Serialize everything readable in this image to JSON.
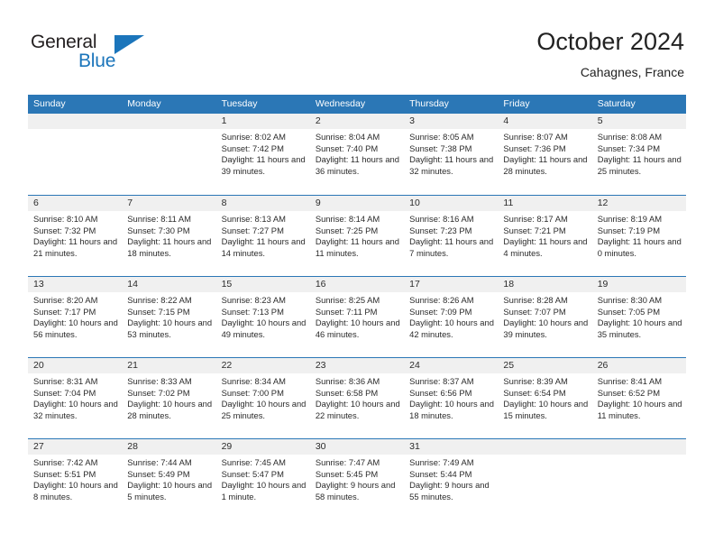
{
  "brand": {
    "name_top": "General",
    "name_bottom": "Blue",
    "accent_color": "#1b75bb"
  },
  "header": {
    "title": "October 2024",
    "subtitle": "Cahagnes, France"
  },
  "calendar": {
    "header_color": "#2b77b6",
    "day_band_color": "#f0f0f0",
    "weekdays": [
      "Sunday",
      "Monday",
      "Tuesday",
      "Wednesday",
      "Thursday",
      "Friday",
      "Saturday"
    ],
    "weeks": [
      [
        {
          "day": "",
          "sunrise": "",
          "sunset": "",
          "daylight": ""
        },
        {
          "day": "",
          "sunrise": "",
          "sunset": "",
          "daylight": ""
        },
        {
          "day": "1",
          "sunrise": "Sunrise: 8:02 AM",
          "sunset": "Sunset: 7:42 PM",
          "daylight": "Daylight: 11 hours and 39 minutes."
        },
        {
          "day": "2",
          "sunrise": "Sunrise: 8:04 AM",
          "sunset": "Sunset: 7:40 PM",
          "daylight": "Daylight: 11 hours and 36 minutes."
        },
        {
          "day": "3",
          "sunrise": "Sunrise: 8:05 AM",
          "sunset": "Sunset: 7:38 PM",
          "daylight": "Daylight: 11 hours and 32 minutes."
        },
        {
          "day": "4",
          "sunrise": "Sunrise: 8:07 AM",
          "sunset": "Sunset: 7:36 PM",
          "daylight": "Daylight: 11 hours and 28 minutes."
        },
        {
          "day": "5",
          "sunrise": "Sunrise: 8:08 AM",
          "sunset": "Sunset: 7:34 PM",
          "daylight": "Daylight: 11 hours and 25 minutes."
        }
      ],
      [
        {
          "day": "6",
          "sunrise": "Sunrise: 8:10 AM",
          "sunset": "Sunset: 7:32 PM",
          "daylight": "Daylight: 11 hours and 21 minutes."
        },
        {
          "day": "7",
          "sunrise": "Sunrise: 8:11 AM",
          "sunset": "Sunset: 7:30 PM",
          "daylight": "Daylight: 11 hours and 18 minutes."
        },
        {
          "day": "8",
          "sunrise": "Sunrise: 8:13 AM",
          "sunset": "Sunset: 7:27 PM",
          "daylight": "Daylight: 11 hours and 14 minutes."
        },
        {
          "day": "9",
          "sunrise": "Sunrise: 8:14 AM",
          "sunset": "Sunset: 7:25 PM",
          "daylight": "Daylight: 11 hours and 11 minutes."
        },
        {
          "day": "10",
          "sunrise": "Sunrise: 8:16 AM",
          "sunset": "Sunset: 7:23 PM",
          "daylight": "Daylight: 11 hours and 7 minutes."
        },
        {
          "day": "11",
          "sunrise": "Sunrise: 8:17 AM",
          "sunset": "Sunset: 7:21 PM",
          "daylight": "Daylight: 11 hours and 4 minutes."
        },
        {
          "day": "12",
          "sunrise": "Sunrise: 8:19 AM",
          "sunset": "Sunset: 7:19 PM",
          "daylight": "Daylight: 11 hours and 0 minutes."
        }
      ],
      [
        {
          "day": "13",
          "sunrise": "Sunrise: 8:20 AM",
          "sunset": "Sunset: 7:17 PM",
          "daylight": "Daylight: 10 hours and 56 minutes."
        },
        {
          "day": "14",
          "sunrise": "Sunrise: 8:22 AM",
          "sunset": "Sunset: 7:15 PM",
          "daylight": "Daylight: 10 hours and 53 minutes."
        },
        {
          "day": "15",
          "sunrise": "Sunrise: 8:23 AM",
          "sunset": "Sunset: 7:13 PM",
          "daylight": "Daylight: 10 hours and 49 minutes."
        },
        {
          "day": "16",
          "sunrise": "Sunrise: 8:25 AM",
          "sunset": "Sunset: 7:11 PM",
          "daylight": "Daylight: 10 hours and 46 minutes."
        },
        {
          "day": "17",
          "sunrise": "Sunrise: 8:26 AM",
          "sunset": "Sunset: 7:09 PM",
          "daylight": "Daylight: 10 hours and 42 minutes."
        },
        {
          "day": "18",
          "sunrise": "Sunrise: 8:28 AM",
          "sunset": "Sunset: 7:07 PM",
          "daylight": "Daylight: 10 hours and 39 minutes."
        },
        {
          "day": "19",
          "sunrise": "Sunrise: 8:30 AM",
          "sunset": "Sunset: 7:05 PM",
          "daylight": "Daylight: 10 hours and 35 minutes."
        }
      ],
      [
        {
          "day": "20",
          "sunrise": "Sunrise: 8:31 AM",
          "sunset": "Sunset: 7:04 PM",
          "daylight": "Daylight: 10 hours and 32 minutes."
        },
        {
          "day": "21",
          "sunrise": "Sunrise: 8:33 AM",
          "sunset": "Sunset: 7:02 PM",
          "daylight": "Daylight: 10 hours and 28 minutes."
        },
        {
          "day": "22",
          "sunrise": "Sunrise: 8:34 AM",
          "sunset": "Sunset: 7:00 PM",
          "daylight": "Daylight: 10 hours and 25 minutes."
        },
        {
          "day": "23",
          "sunrise": "Sunrise: 8:36 AM",
          "sunset": "Sunset: 6:58 PM",
          "daylight": "Daylight: 10 hours and 22 minutes."
        },
        {
          "day": "24",
          "sunrise": "Sunrise: 8:37 AM",
          "sunset": "Sunset: 6:56 PM",
          "daylight": "Daylight: 10 hours and 18 minutes."
        },
        {
          "day": "25",
          "sunrise": "Sunrise: 8:39 AM",
          "sunset": "Sunset: 6:54 PM",
          "daylight": "Daylight: 10 hours and 15 minutes."
        },
        {
          "day": "26",
          "sunrise": "Sunrise: 8:41 AM",
          "sunset": "Sunset: 6:52 PM",
          "daylight": "Daylight: 10 hours and 11 minutes."
        }
      ],
      [
        {
          "day": "27",
          "sunrise": "Sunrise: 7:42 AM",
          "sunset": "Sunset: 5:51 PM",
          "daylight": "Daylight: 10 hours and 8 minutes."
        },
        {
          "day": "28",
          "sunrise": "Sunrise: 7:44 AM",
          "sunset": "Sunset: 5:49 PM",
          "daylight": "Daylight: 10 hours and 5 minutes."
        },
        {
          "day": "29",
          "sunrise": "Sunrise: 7:45 AM",
          "sunset": "Sunset: 5:47 PM",
          "daylight": "Daylight: 10 hours and 1 minute."
        },
        {
          "day": "30",
          "sunrise": "Sunrise: 7:47 AM",
          "sunset": "Sunset: 5:45 PM",
          "daylight": "Daylight: 9 hours and 58 minutes."
        },
        {
          "day": "31",
          "sunrise": "Sunrise: 7:49 AM",
          "sunset": "Sunset: 5:44 PM",
          "daylight": "Daylight: 9 hours and 55 minutes."
        },
        {
          "day": "",
          "sunrise": "",
          "sunset": "",
          "daylight": ""
        },
        {
          "day": "",
          "sunrise": "",
          "sunset": "",
          "daylight": ""
        }
      ]
    ]
  }
}
